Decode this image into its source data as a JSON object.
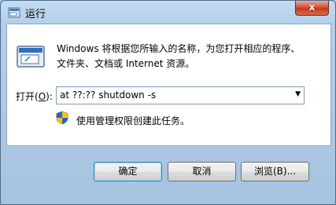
{
  "window": {
    "title": "运行",
    "close_label": "x"
  },
  "content": {
    "description_line1": "Windows 将根据您所输入的名称，为您打开相应的程序、",
    "description_line2": "文件夹、文档或 Internet 资源。",
    "open_label": "打开(",
    "open_accel": "O",
    "open_label_end": "):",
    "command_value": "at ??:?? shutdown -s",
    "admin_note": "使用管理权限创建此任务。"
  },
  "buttons": {
    "ok": "确定",
    "cancel": "取消",
    "browse": "浏览(B)..."
  },
  "icons": {
    "title": "run-icon",
    "main": "run-program-icon",
    "admin": "uac-shield-icon",
    "dropdown": "dropdown-arrow-icon"
  }
}
